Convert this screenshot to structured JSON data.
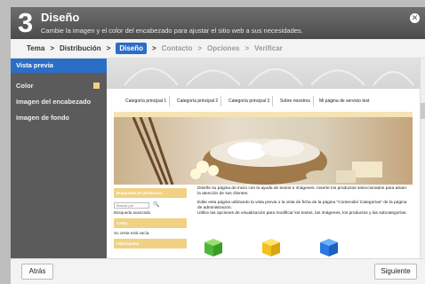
{
  "header": {
    "step_number": "3",
    "title": "Diseño",
    "subtitle": "Cambie la imagen y el color del encabezado para ajustar el sitio web a sus necesidades."
  },
  "breadcrumb": {
    "steps": [
      "Tema",
      "Distribución",
      "Diseño",
      "Contacto",
      "Opciones",
      "Verificar"
    ],
    "separator": ">",
    "active_index": 2
  },
  "sidebar": {
    "items": [
      {
        "label": "Vista previa"
      },
      {
        "label": "Color"
      },
      {
        "label": "Imagen del encabezado"
      },
      {
        "label": "Imagen de fondo"
      }
    ],
    "color_swatch": "#f1d184",
    "active_color": "#2a6ec8"
  },
  "preview": {
    "nav_items": [
      "Categoría principal 1",
      "Categoría principal 2",
      "Categoría principal 3",
      "Sobre nosotros",
      "Mi página de servicio test"
    ],
    "sidebar_box1_title": "Búsqueda de productos",
    "search_placeholder": "Buscar por",
    "advanced_search": "Búsqueda avanzada",
    "sidebar_box2_title": "Cesta",
    "cart_text": "Su cesta está vacía.",
    "sidebar_box3_title": "Fabricantes",
    "main_text_1": "Diseñe su página de inicio con la ayuda de textos e imágenes. Inserte los productos seleccionados para atraer la atención de sus clientes.",
    "main_text_2": "Edite esta página utilizando la vista previa o la vista de ficha de la página \"Contenido/ Categorías\" de la página de administración.",
    "main_text_3": "Utilice las opciones de visualización para modificar los textos, las imágenes, los productos y las subcategorías."
  },
  "footer": {
    "back_label": "Atrás",
    "next_label": "Siguiente"
  }
}
